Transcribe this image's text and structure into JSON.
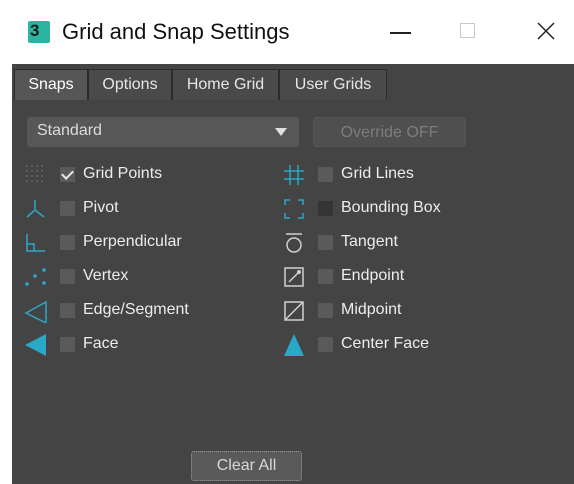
{
  "window": {
    "title": "Grid and Snap Settings",
    "app_icon_label": "3",
    "controls": {
      "minimize": "minimize-icon",
      "maximize": "maximize-icon",
      "close": "close-icon"
    }
  },
  "tabs": [
    {
      "label": "Snaps",
      "active": true
    },
    {
      "label": "Options",
      "active": false
    },
    {
      "label": "Home Grid",
      "active": false
    },
    {
      "label": "User Grids",
      "active": false
    }
  ],
  "snaps": {
    "dropdown": {
      "value": "Standard"
    },
    "override_button": "Override OFF",
    "left_column": [
      {
        "label": "Grid Points",
        "checked": true,
        "icon": "grid-points-icon"
      },
      {
        "label": "Pivot",
        "checked": false,
        "icon": "pivot-icon"
      },
      {
        "label": "Perpendicular",
        "checked": false,
        "icon": "perpendicular-icon"
      },
      {
        "label": "Vertex",
        "checked": false,
        "icon": "vertex-icon"
      },
      {
        "label": "Edge/Segment",
        "checked": false,
        "icon": "edge-segment-icon"
      },
      {
        "label": "Face",
        "checked": false,
        "icon": "face-icon"
      }
    ],
    "right_column": [
      {
        "label": "Grid Lines",
        "checked": false,
        "icon": "grid-lines-icon"
      },
      {
        "label": "Bounding Box",
        "checked": false,
        "icon": "bounding-box-icon"
      },
      {
        "label": "Tangent",
        "checked": false,
        "icon": "tangent-icon"
      },
      {
        "label": "Endpoint",
        "checked": false,
        "icon": "endpoint-icon"
      },
      {
        "label": "Midpoint",
        "checked": false,
        "icon": "midpoint-icon"
      },
      {
        "label": "Center Face",
        "checked": false,
        "icon": "center-face-icon"
      }
    ],
    "clear_all_button": "Clear All"
  },
  "colors": {
    "panel_bg": "#444444",
    "icon_teal": "#2aa8c8",
    "app_icon_teal": "#2bb5a0"
  }
}
